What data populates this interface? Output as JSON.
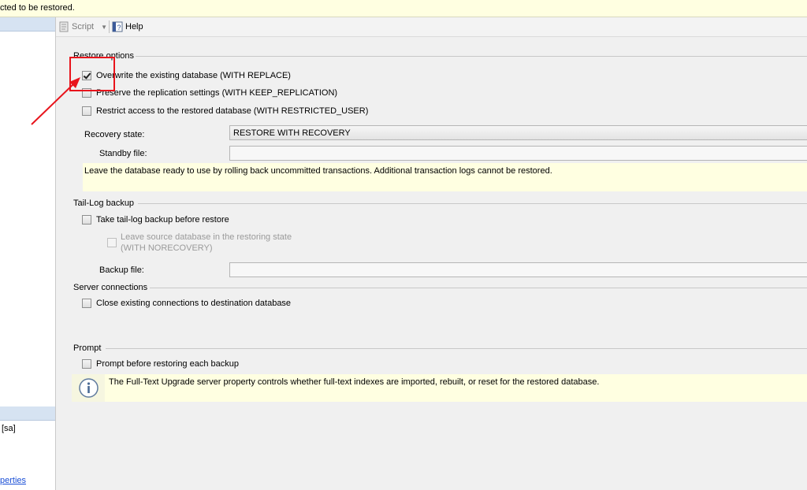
{
  "message_bar": {
    "text": "cted to be restored."
  },
  "left_pane": {
    "login_text": "[sa]",
    "properties_link": "perties"
  },
  "toolbar": {
    "script_label": "Script",
    "help_label": "Help"
  },
  "restore_options": {
    "title": "Restore options",
    "overwrite_label": "Overwrite the existing database (WITH REPLACE)",
    "preserve_label": "Preserve the replication settings (WITH KEEP_REPLICATION)",
    "restrict_label": "Restrict access to the restored database (WITH RESTRICTED_USER)",
    "recovery_state_label": "Recovery state:",
    "recovery_state_value": "RESTORE WITH RECOVERY",
    "standby_label": "Standby file:",
    "standby_value": "",
    "recovery_description": "Leave the database ready to use by rolling back uncommitted transactions. Additional transaction logs cannot be restored."
  },
  "tail_log": {
    "title": "Tail-Log backup",
    "take_tail_label": "Take tail-log backup before restore",
    "leave_source_label_1": "Leave source database in the restoring state",
    "leave_source_label_2": "(WITH NORECOVERY)",
    "backup_file_label": "Backup file:",
    "backup_file_value": ""
  },
  "server_connections": {
    "title": "Server connections",
    "close_label": "Close existing connections to destination database"
  },
  "prompt": {
    "title": "Prompt",
    "prompt_label": "Prompt before restoring each backup",
    "info_text": "The Full-Text Upgrade server property controls whether full-text indexes are imported, rebuilt, or reset for the restored database."
  },
  "colors": {
    "annotation": "#e8141c",
    "info_background": "#ffffe1",
    "link": "#1a4fd6"
  }
}
